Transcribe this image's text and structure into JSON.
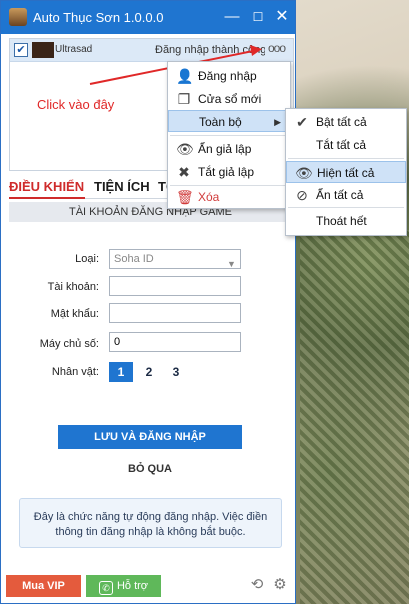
{
  "window": {
    "title": "Auto Thục Sơn 1.0.0.0",
    "min_glyph": "—",
    "max_glyph": "☐",
    "close_glyph": "✕"
  },
  "account": {
    "name": "Ultrasad",
    "status": "Đăng nhập thành công",
    "more_glyph": "ooo",
    "checked": true
  },
  "annotation": {
    "text": "Click vào đây",
    "color": "#e02828"
  },
  "tabs": [
    {
      "label": "ĐIỀU KHIỂN",
      "active": true
    },
    {
      "label": "TIỆN ÍCH",
      "active": false
    },
    {
      "label": "TỐ",
      "active": false
    }
  ],
  "login_form": {
    "header": "TÀI KHOẢN ĐĂNG NHẬP GAME",
    "type_label": "Loại:",
    "type_value": "Soha ID",
    "account_label": "Tài khoản:",
    "account_value": "",
    "password_label": "Mật khẩu:",
    "password_value": "",
    "server_label": "Máy chủ số:",
    "server_value": "0",
    "character_label": "Nhân vật:",
    "characters": [
      "1",
      "2",
      "3"
    ],
    "selected_character": "1",
    "save_login_label": "LƯU VÀ ĐĂNG NHẬP",
    "skip_label": "BỎ QUA",
    "info_text": "Đây là chức năng tự động đăng nhập. Việc điền thông tin đăng nhập là không bắt buộc."
  },
  "bottom": {
    "vip_label": "Mua VIP",
    "support_label": "Hỗ trợ"
  },
  "context_menu": {
    "items": [
      {
        "icon": "user-icon",
        "label": "Đăng nhập"
      },
      {
        "icon": "window-icon",
        "label": "Cửa sổ mới"
      },
      {
        "icon": "",
        "label": "Toàn bộ",
        "highlighted": true,
        "submenu": true
      },
      {
        "icon": "eye-icon",
        "label": "Ẩn giả lập"
      },
      {
        "icon": "x-icon",
        "label": "Tắt giả lập"
      },
      {
        "icon": "trash-icon",
        "label": "Xóa",
        "danger": true
      }
    ]
  },
  "submenu": {
    "items": [
      {
        "label": "Bật tất cả",
        "checked": true
      },
      {
        "label": "Tắt tất cả"
      },
      {
        "label": "Hiện tất cả",
        "icon": "eye-icon",
        "highlighted": true
      },
      {
        "label": "Ẩn tất cả",
        "icon": "eye-slash-icon"
      },
      {
        "label": "Thoát hết"
      }
    ]
  },
  "colors": {
    "accent": "#1f75d0",
    "active_tab": "#cf2b2b",
    "vip": "#e45b3d",
    "support": "#5fb85a"
  }
}
